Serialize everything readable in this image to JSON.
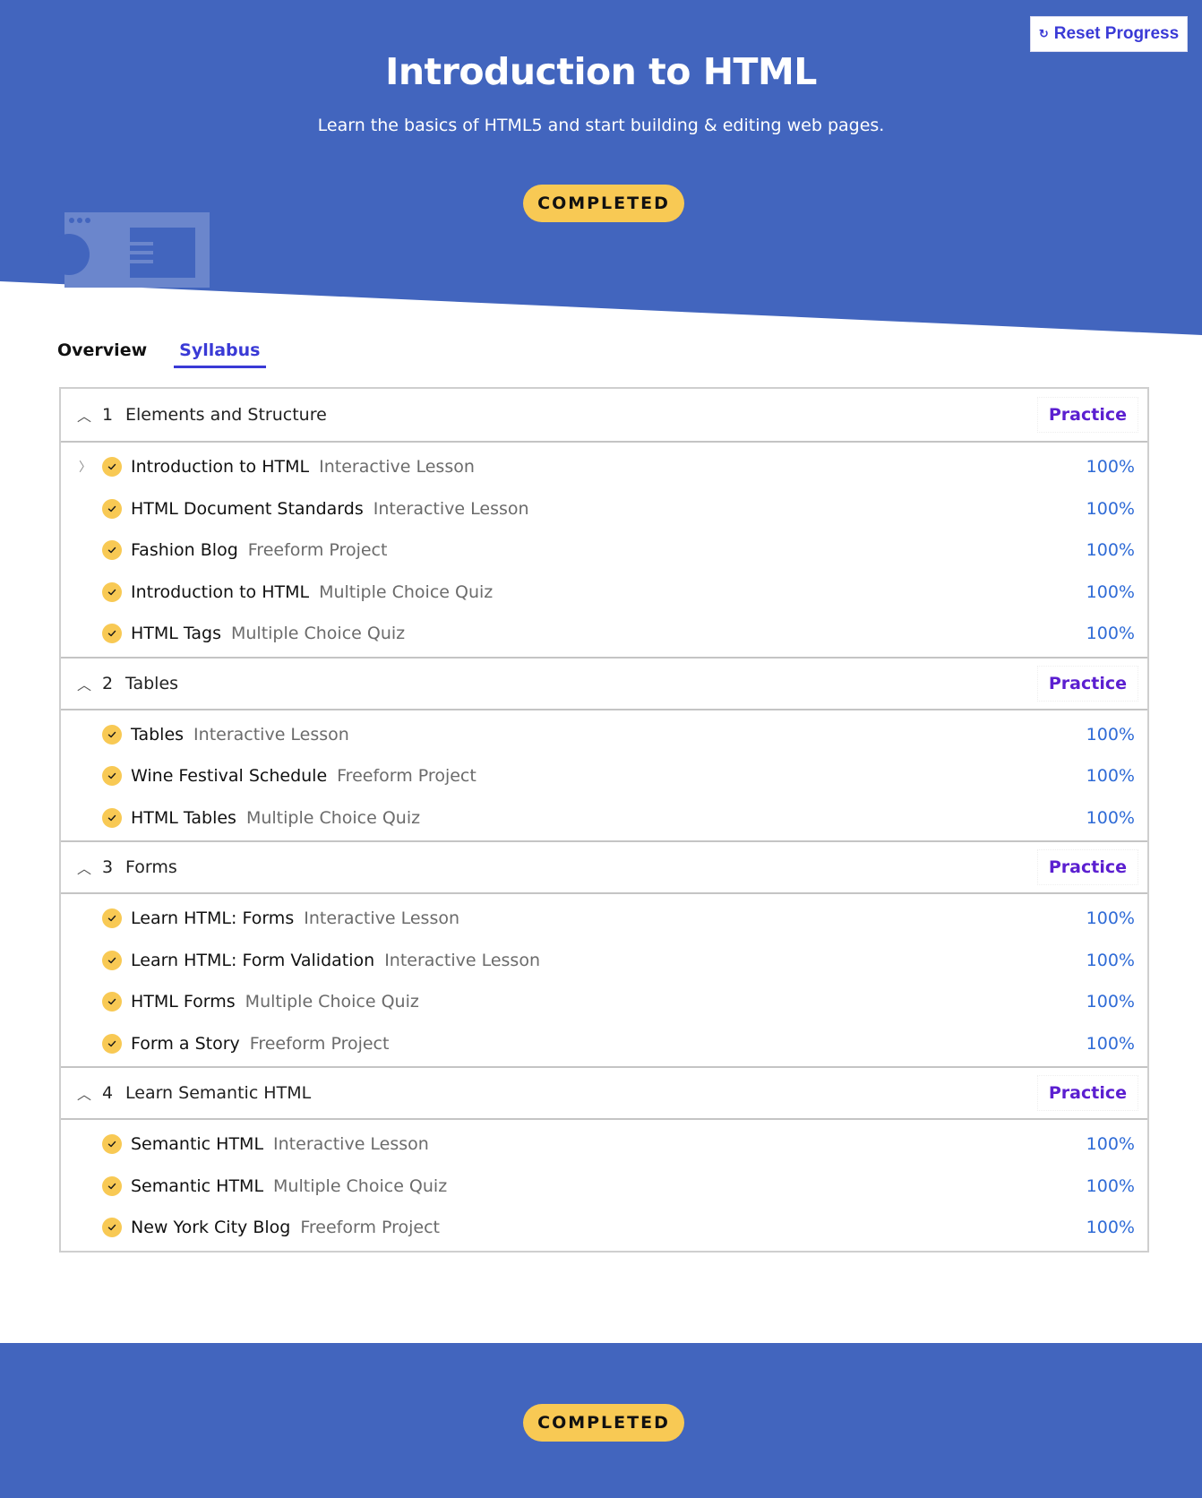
{
  "header": {
    "title": "Introduction to HTML",
    "subtitle": "Learn the basics of HTML5 and start building & editing web pages.",
    "status_badge": "COMPLETED",
    "reset_label": "Reset Progress"
  },
  "tabs": [
    {
      "label": "Overview",
      "active": false
    },
    {
      "label": "Syllabus",
      "active": true
    }
  ],
  "modules": [
    {
      "number": "1",
      "title": "Elements and Structure",
      "practice_label": "Practice",
      "items": [
        {
          "title": "Introduction to HTML",
          "type": "Interactive Lesson",
          "progress": "100%"
        },
        {
          "title": "HTML Document Standards",
          "type": "Interactive Lesson",
          "progress": "100%"
        },
        {
          "title": "Fashion Blog",
          "type": "Freeform Project",
          "progress": "100%"
        },
        {
          "title": "Introduction to HTML",
          "type": "Multiple Choice Quiz",
          "progress": "100%"
        },
        {
          "title": "HTML Tags",
          "type": "Multiple Choice Quiz",
          "progress": "100%"
        }
      ]
    },
    {
      "number": "2",
      "title": "Tables",
      "practice_label": "Practice",
      "items": [
        {
          "title": "Tables",
          "type": "Interactive Lesson",
          "progress": "100%"
        },
        {
          "title": "Wine Festival Schedule",
          "type": "Freeform Project",
          "progress": "100%"
        },
        {
          "title": "HTML Tables",
          "type": "Multiple Choice Quiz",
          "progress": "100%"
        }
      ]
    },
    {
      "number": "3",
      "title": "Forms",
      "practice_label": "Practice",
      "items": [
        {
          "title": "Learn HTML: Forms",
          "type": "Interactive Lesson",
          "progress": "100%"
        },
        {
          "title": "Learn HTML: Form Validation",
          "type": "Interactive Lesson",
          "progress": "100%"
        },
        {
          "title": "HTML Forms",
          "type": "Multiple Choice Quiz",
          "progress": "100%"
        },
        {
          "title": "Form a Story",
          "type": "Freeform Project",
          "progress": "100%"
        }
      ]
    },
    {
      "number": "4",
      "title": "Learn Semantic HTML",
      "practice_label": "Practice",
      "items": [
        {
          "title": "Semantic HTML",
          "type": "Interactive Lesson",
          "progress": "100%"
        },
        {
          "title": "Semantic HTML",
          "type": "Multiple Choice Quiz",
          "progress": "100%"
        },
        {
          "title": "New York City Blog",
          "type": "Freeform Project",
          "progress": "100%"
        }
      ]
    }
  ],
  "footer": {
    "status_badge": "COMPLETED"
  },
  "colors": {
    "brand_blue": "#4265be",
    "badge_yellow": "#f8c954",
    "accent_purple": "#5b1fd0",
    "tab_active": "#3a3ad6",
    "progress_blue": "#2f6bd6"
  },
  "icons": {
    "reset": "refresh-icon",
    "check": "check-circle-icon",
    "module_toggle": "chevron-up-icon",
    "item_expander": "chevron-right-icon"
  }
}
